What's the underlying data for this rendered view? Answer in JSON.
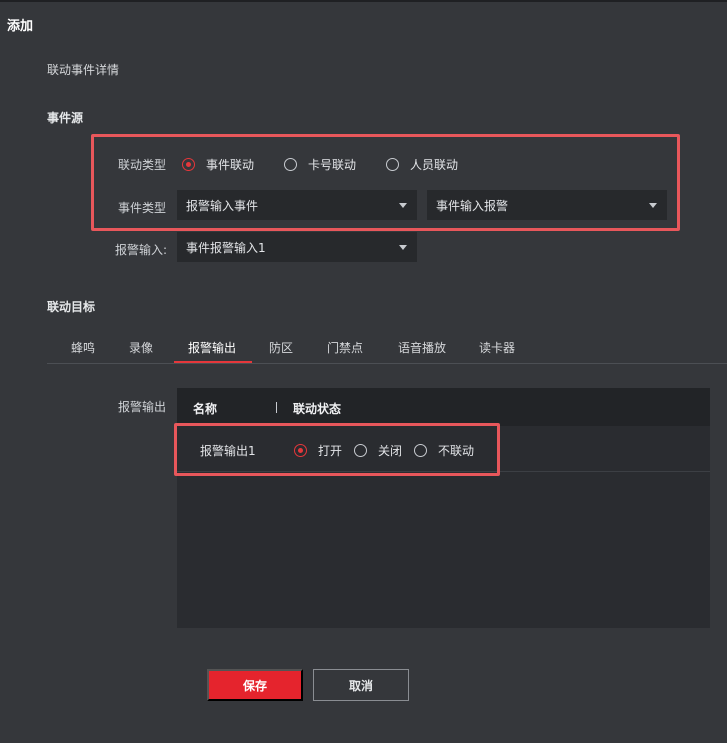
{
  "dialog": {
    "title": "添加",
    "subtitle": "联动事件详情"
  },
  "event_source": {
    "section_title": "事件源",
    "linkage_type": {
      "label": "联动类型",
      "options": [
        {
          "label": "事件联动",
          "checked": true
        },
        {
          "label": "卡号联动",
          "checked": false
        },
        {
          "label": "人员联动",
          "checked": false
        }
      ]
    },
    "event_type": {
      "label": "事件类型",
      "primary_value": "报警输入事件",
      "secondary_value": "事件输入报警"
    },
    "alarm_input": {
      "label": "报警输入:",
      "value": "事件报警输入1"
    }
  },
  "linkage_target": {
    "section_title": "联动目标",
    "tabs": [
      {
        "label": "蜂鸣",
        "active": false
      },
      {
        "label": "录像",
        "active": false
      },
      {
        "label": "报警输出",
        "active": true
      },
      {
        "label": "防区",
        "active": false
      },
      {
        "label": "门禁点",
        "active": false
      },
      {
        "label": "语音播放",
        "active": false
      },
      {
        "label": "读卡器",
        "active": false
      }
    ],
    "alarm_output": {
      "label": "报警输出",
      "columns": [
        "名称",
        "联动状态"
      ],
      "rows": [
        {
          "name": "报警输出1",
          "states": [
            {
              "label": "打开",
              "checked": true
            },
            {
              "label": "关闭",
              "checked": false
            },
            {
              "label": "不联动",
              "checked": false
            }
          ]
        }
      ]
    }
  },
  "footer": {
    "save_label": "保存",
    "cancel_label": "取消"
  },
  "colors": {
    "background": "#35373b",
    "accent": "#e6373b",
    "highlight_box": "#e8575b",
    "input_bg": "#27292c"
  }
}
